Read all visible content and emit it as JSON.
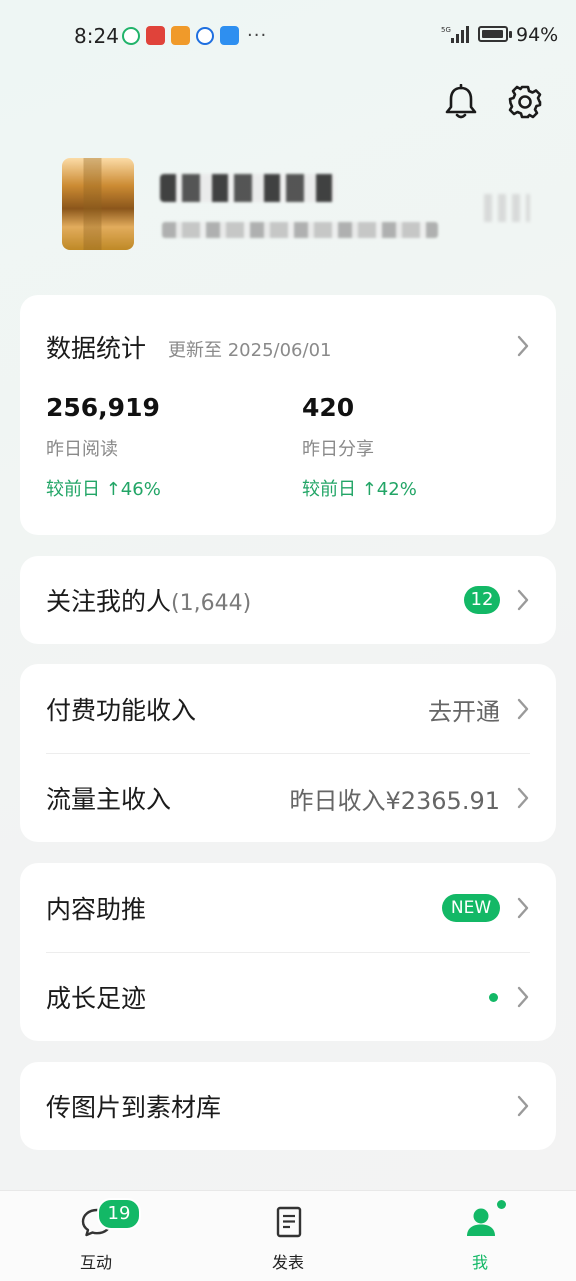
{
  "status_bar": {
    "time": "8:24",
    "notification_more": "···",
    "battery": "94%",
    "network": "5G"
  },
  "stats": {
    "title": "数据统计",
    "updated": "更新至 2025/06/01",
    "reads": {
      "value": "256,919",
      "label": "昨日阅读",
      "delta": "较前日 ↑46%"
    },
    "shares": {
      "value": "420",
      "label": "昨日分享",
      "delta": "较前日 ↑42%"
    }
  },
  "followers": {
    "label": "关注我的人",
    "count": "(1,644)",
    "badge": "12"
  },
  "income": {
    "paid_label": "付费功能收入",
    "paid_action": "去开通",
    "traffic_label": "流量主收入",
    "traffic_value": "昨日收入¥2365.91"
  },
  "promo": {
    "content_boost_label": "内容助推",
    "content_boost_badge": "NEW",
    "growth_label": "成长足迹"
  },
  "upload": {
    "label": "传图片到素材库"
  },
  "nav": {
    "interact_label": "互动",
    "interact_badge": "19",
    "publish_label": "发表",
    "me_label": "我"
  },
  "colors": {
    "accent": "#13b866",
    "delta": "#22a566"
  }
}
